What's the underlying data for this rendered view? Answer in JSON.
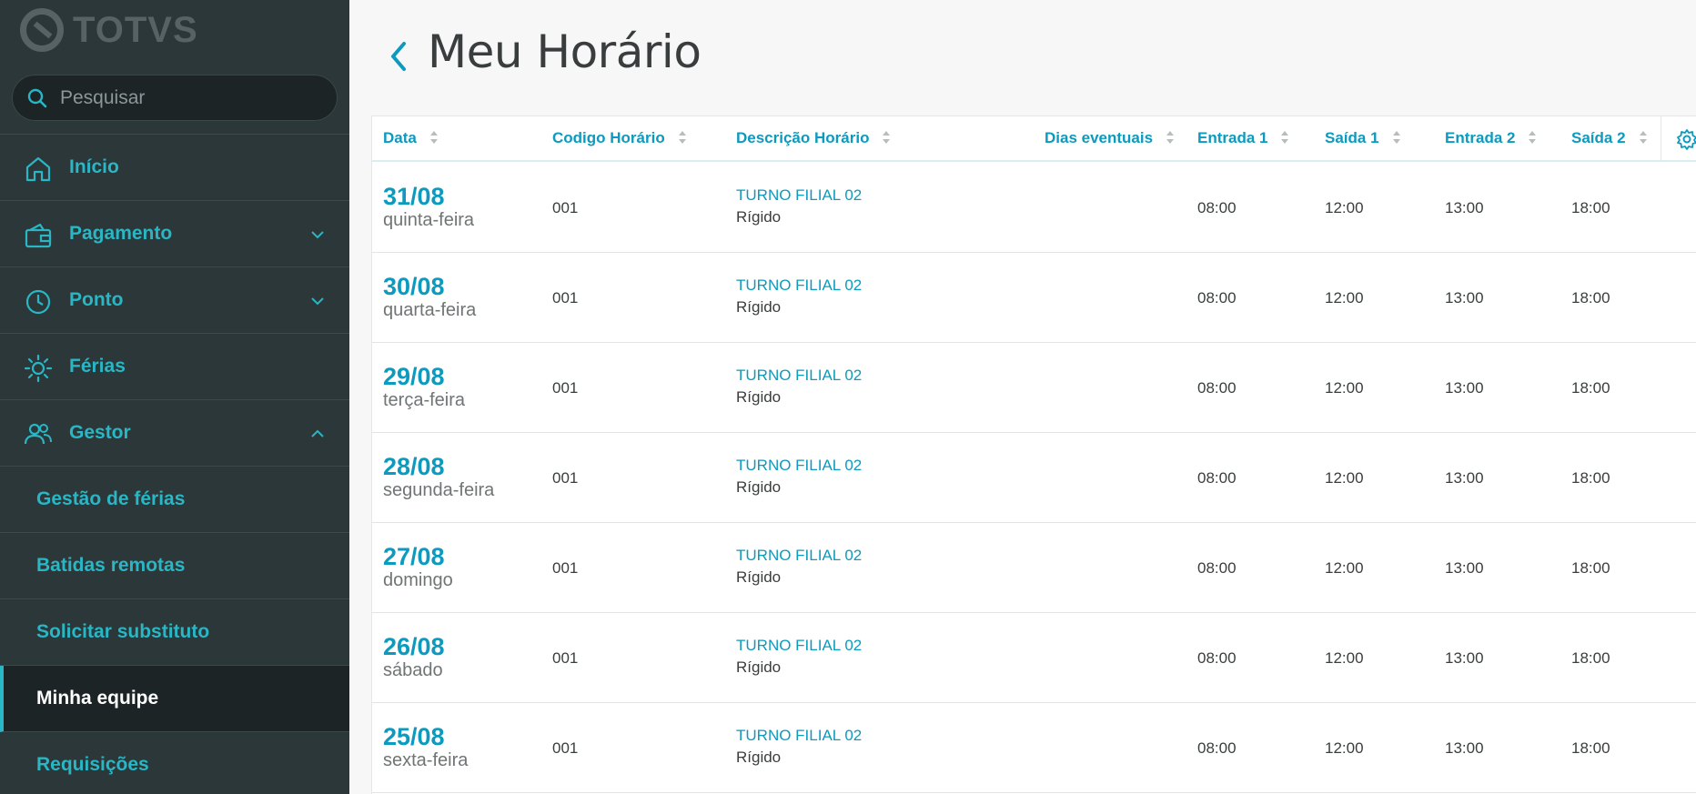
{
  "brand": {
    "logo_text": "TOTVS"
  },
  "search": {
    "placeholder": "Pesquisar"
  },
  "menu": {
    "inicio": "Início",
    "pagamento": "Pagamento",
    "ponto": "Ponto",
    "ferias": "Férias",
    "gestor": "Gestor",
    "gestor_items": [
      "Gestão de férias",
      "Batidas remotas",
      "Solicitar substituto",
      "Minha equipe",
      "Requisições"
    ],
    "active_item": "Minha equipe"
  },
  "page": {
    "title": "Meu Horário"
  },
  "table": {
    "headers": [
      "Data",
      "Codigo Horário",
      "Descrição Horário",
      "Dias eventuais",
      "Entrada 1",
      "Saída 1",
      "Entrada 2",
      "Saída 2"
    ],
    "rows": [
      {
        "date": "31/08",
        "weekday": "quinta-feira",
        "code": "001",
        "desc": "TURNO FILIAL 02",
        "type": "Rígido",
        "eventuais": "",
        "e1": "08:00",
        "s1": "12:00",
        "e2": "13:00",
        "s2": "18:00"
      },
      {
        "date": "30/08",
        "weekday": "quarta-feira",
        "code": "001",
        "desc": "TURNO FILIAL 02",
        "type": "Rígido",
        "eventuais": "",
        "e1": "08:00",
        "s1": "12:00",
        "e2": "13:00",
        "s2": "18:00"
      },
      {
        "date": "29/08",
        "weekday": "terça-feira",
        "code": "001",
        "desc": "TURNO FILIAL 02",
        "type": "Rígido",
        "eventuais": "",
        "e1": "08:00",
        "s1": "12:00",
        "e2": "13:00",
        "s2": "18:00"
      },
      {
        "date": "28/08",
        "weekday": "segunda-feira",
        "code": "001",
        "desc": "TURNO FILIAL 02",
        "type": "Rígido",
        "eventuais": "",
        "e1": "08:00",
        "s1": "12:00",
        "e2": "13:00",
        "s2": "18:00"
      },
      {
        "date": "27/08",
        "weekday": "domingo",
        "code": "001",
        "desc": "TURNO FILIAL 02",
        "type": "Rígido",
        "eventuais": "",
        "e1": "08:00",
        "s1": "12:00",
        "e2": "13:00",
        "s2": "18:00"
      },
      {
        "date": "26/08",
        "weekday": "sábado",
        "code": "001",
        "desc": "TURNO FILIAL 02",
        "type": "Rígido",
        "eventuais": "",
        "e1": "08:00",
        "s1": "12:00",
        "e2": "13:00",
        "s2": "18:00"
      },
      {
        "date": "25/08",
        "weekday": "sexta-feira",
        "code": "001",
        "desc": "TURNO FILIAL 02",
        "type": "Rígido",
        "eventuais": "",
        "e1": "08:00",
        "s1": "12:00",
        "e2": "13:00",
        "s2": "18:00"
      }
    ]
  },
  "colors": {
    "accent": "#0c9abe",
    "sidebar_bg": "#2c3739",
    "menu_text": "#29b6c5"
  },
  "icons": {
    "search": "search-icon",
    "home": "home-icon",
    "wallet": "wallet-icon",
    "clock": "clock-icon",
    "sun": "sun-icon",
    "people": "people-icon",
    "settings": "gear-icon",
    "back": "chevron-left-icon"
  }
}
